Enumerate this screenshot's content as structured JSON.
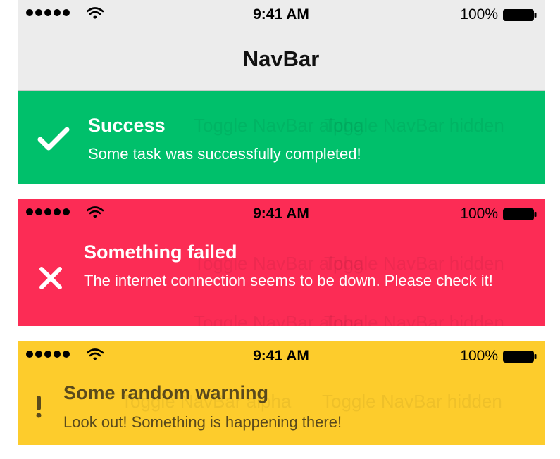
{
  "status_bar": {
    "time": "9:41 AM",
    "battery_percent": "100%",
    "signal_icon": "signal-dots-icon",
    "wifi_icon": "wifi-icon",
    "battery_icon": "battery-icon"
  },
  "navbar": {
    "title": "NavBar"
  },
  "background": {
    "toggle_alpha_label": "Toggle NavBar alpha",
    "toggle_hidden_label": "Toggle NavBar hidden"
  },
  "banners": {
    "success": {
      "title": "Success",
      "message": "Some task was successfully completed!",
      "icon": "checkmark-icon",
      "color": "#00c06b"
    },
    "error": {
      "title": "Something failed",
      "message": "The internet connection seems to be down. Please check it!",
      "icon": "close-icon",
      "color": "#fc2c55"
    },
    "warning": {
      "title": "Some random warning",
      "message": "Look out! Something is happening there!",
      "icon": "exclamation-icon",
      "color": "#fdcc2c"
    }
  }
}
